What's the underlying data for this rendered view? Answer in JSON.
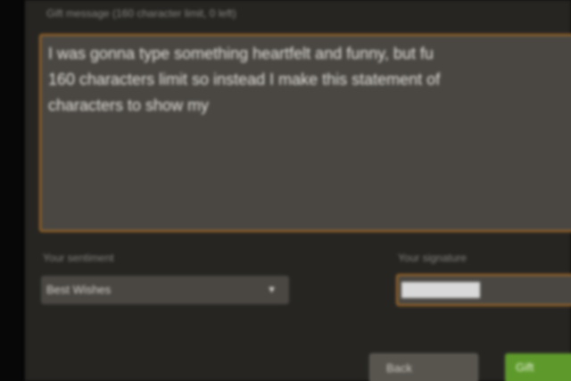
{
  "message": {
    "label": "Gift message (160 character limit, 0 left)",
    "text": "I was gonna type something heartfelt and funny, but fu\n160 characters limit so instead I make this statement of\ncharacters to show my"
  },
  "sentiment": {
    "label": "Your sentiment",
    "selected": "Best Wishes",
    "icon": "chevron-down-icon"
  },
  "signature": {
    "label": "Your signature",
    "value": ""
  },
  "actions": {
    "back_label": "Back",
    "send_label": "Gift"
  },
  "colors": {
    "panel_bg": "#262522",
    "field_bg": "#4a4743",
    "focus_border": "#a66a22",
    "send_green": "#5e9a2b"
  }
}
